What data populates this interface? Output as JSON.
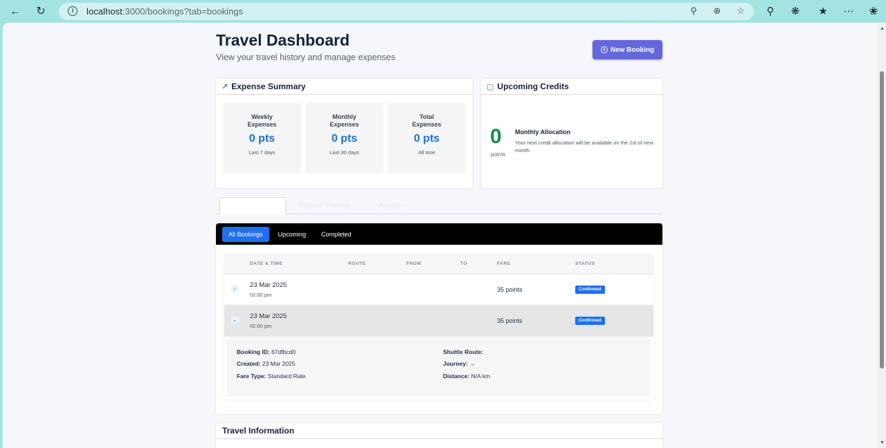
{
  "browser": {
    "url_host": "localhost",
    "url_path": ":3000/bookings?tab=bookings"
  },
  "page": {
    "title": "Travel Dashboard",
    "subtitle": "View your travel history and manage expenses",
    "new_booking_label": "New Booking"
  },
  "expense_summary": {
    "title": "Expense Summary",
    "stats": [
      {
        "label": "Weekly Expenses",
        "value": "0 pts",
        "sub": "Last 7 days"
      },
      {
        "label": "Monthly Expenses",
        "value": "0 pts",
        "sub": "Last 30 days"
      },
      {
        "label": "Total Expenses",
        "value": "0 pts",
        "sub": "All time"
      }
    ]
  },
  "credits": {
    "title": "Upcoming Credits",
    "amount": "0",
    "unit": "points",
    "alloc_title": "Monthly Allocation",
    "alloc_text": "Your next credit allocation will be available on the 1st of next month."
  },
  "tabs": {
    "items": [
      "Expense Tracking",
      "Analytics"
    ]
  },
  "filters": {
    "items": [
      "All Bookings",
      "Upcoming",
      "Completed"
    ],
    "active": "All Bookings"
  },
  "table": {
    "headers": [
      "DATE & TIME",
      "ROUTE",
      "FROM",
      "TO",
      "FARE",
      "STATUS"
    ],
    "rows": [
      {
        "date": "23 Mar 2025",
        "time": "02:00 pm",
        "fare": "35 points",
        "status": "Confirmed"
      },
      {
        "date": "23 Mar 2025",
        "time": "02:00 pm",
        "fare": "35 points",
        "status": "Confirmed"
      }
    ]
  },
  "details": {
    "booking_id_label": "Booking ID:",
    "booking_id": "67dfbcd0",
    "created_label": "Created:",
    "created": "23 Mar 2025",
    "fare_type_label": "Fare Type:",
    "fare_type": "Standard Rate",
    "shuttle_route_label": "Shuttle Route:",
    "shuttle_route": "",
    "journey_label": "Journey:",
    "journey": "→",
    "distance_label": "Distance:",
    "distance": "N/A km"
  },
  "travel_info": {
    "title": "Travel Information"
  },
  "colors": {
    "accent": "#6366dd",
    "primary_blue": "#1f6ff0",
    "credit_green": "#1f8a4c"
  }
}
